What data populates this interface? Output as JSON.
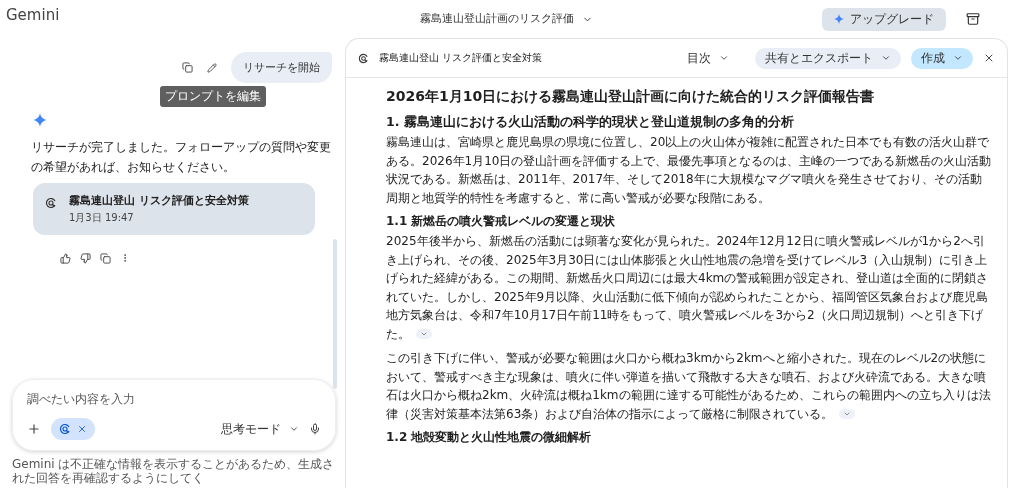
{
  "app_name": "Gemini",
  "conversation_title": "霧島連山登山計画のリスク評価",
  "upgrade_button": "アップグレード",
  "chat": {
    "user_message": "リサーチを開始",
    "tooltip": "プロンプトを編集",
    "response": "リサーチが完了しました。フォローアップの質問や変更の希望があれば、お知らせください。",
    "report_card": {
      "title": "霧島連山登山 リスク評価と安全対策",
      "date": "1月3日 19:47"
    }
  },
  "input": {
    "placeholder": "調べたい内容を入力",
    "mode": "思考モード"
  },
  "footer": "Gemini は不正確な情報を表示することがあるため、生成された回答を再確認するようにしてく",
  "document": {
    "title": "霧島連山登山 リスク評価と安全対策",
    "toolbar": [
      {
        "label": "目次",
        "kind": "plain"
      },
      {
        "label": "共有とエクスポート",
        "kind": "tonal"
      },
      {
        "label": "作成",
        "kind": "primary"
      }
    ],
    "heading": "2026年1月10日における霧島連山登山計画に向けた統合的リスク評価報告書",
    "sections": [
      {
        "kind": "h2",
        "text": "1. 霧島連山における火山活動の科学的現状と登山道規制の多角的分析"
      },
      {
        "kind": "p",
        "expandable": false,
        "text": "霧島連山は、宮崎県と鹿児島県の県境に位置し、20以上の火山体が複雑に配置された日本でも有数の活火山群である。2026年1月10日の登山計画を評価する上で、最優先事項となるのは、主峰の一つである新燃岳の火山活動状況である。新燃岳は、2011年、2017年、そして2018年に大規模なマグマ噴火を発生させており、その活動周期と地質学的特性を考慮すると、常に高い警戒が必要な段階にある。"
      },
      {
        "kind": "h3",
        "text": "1.1 新燃岳の噴火警戒レベルの変遷と現状"
      },
      {
        "kind": "p",
        "expandable": true,
        "text": "2025年後半から、新燃岳の活動には顕著な変化が見られた。2024年12月12日に噴火警戒レベルが1から2へ引き上げられ、その後、2025年3月30日には山体膨張と火山性地震の急増を受けてレベル3（入山規制）に引き上げられた経緯がある。この期間、新燃岳火口周辺には最大4kmの警戒範囲が設定され、登山道は全面的に閉鎖されていた。しかし、2025年9月以降、火山活動に低下傾向が認められたことから、福岡管区気象台および鹿児島地方気象台は、令和7年10月17日午前11時をもって、噴火警戒レベルを3から2（火口周辺規制）へと引き下げた。"
      },
      {
        "kind": "p",
        "expandable": true,
        "text": "この引き下げに伴い、警戒が必要な範囲は火口から概ね3kmから2kmへと縮小された。現在のレベル2の状態において、警戒すべき主な現象は、噴火に伴い弾道を描いて飛散する大きな噴石、および火砕流である。大きな噴石は火口から概ね2km、火砕流は概ね1kmの範囲に達する可能性があるため、これらの範囲内への立ち入りは法律（災害対策基本法第63条）および自治体の指示によって厳格に制限されている。"
      },
      {
        "kind": "h3",
        "text": "1.2 地殻変動と火山性地震の微細解析"
      }
    ]
  }
}
